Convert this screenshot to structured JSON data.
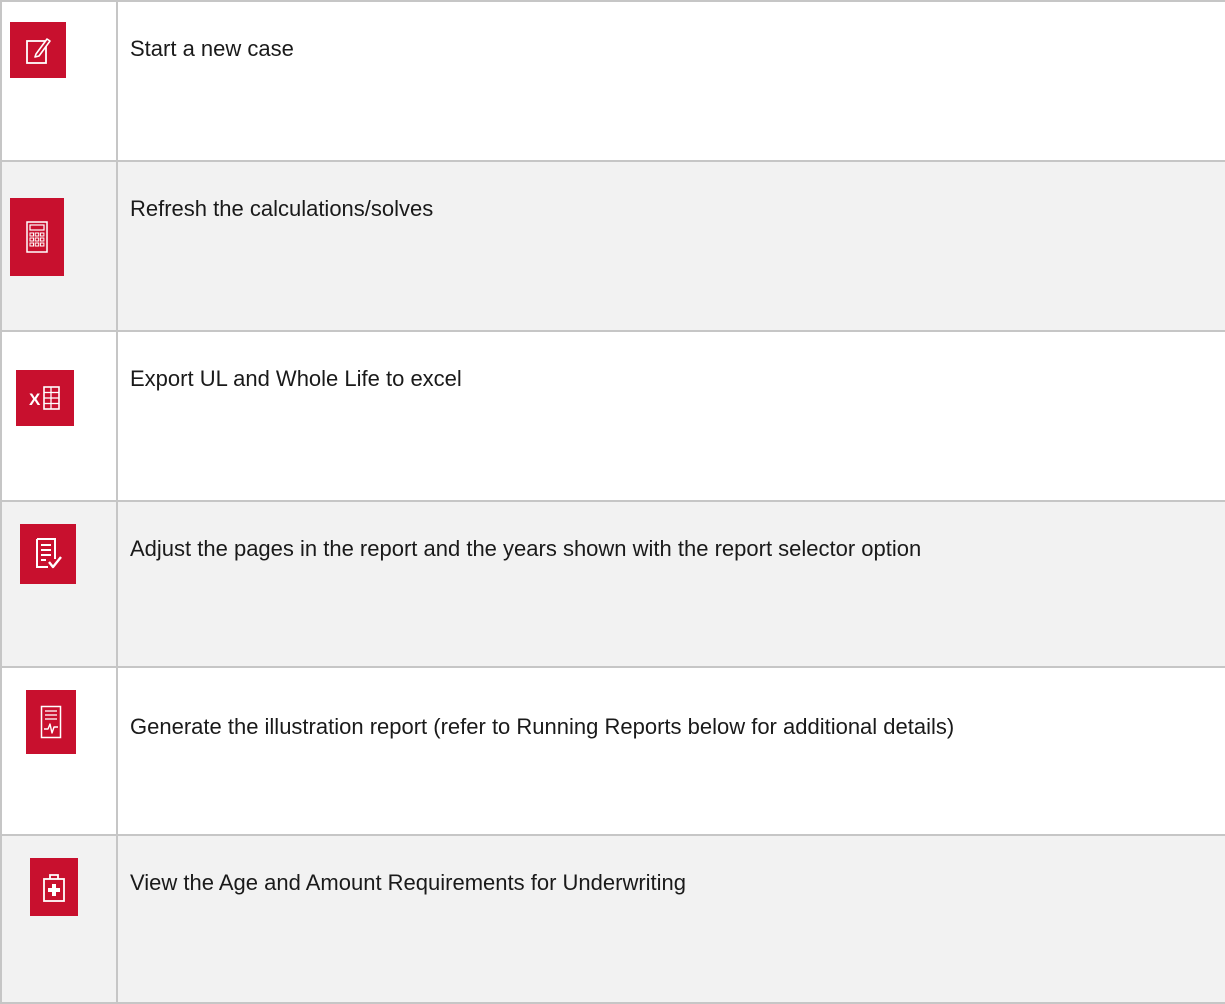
{
  "rows": [
    {
      "icon": "edit-icon",
      "text": "Start a new case"
    },
    {
      "icon": "calculator-icon",
      "text": "Refresh the calculations/solves"
    },
    {
      "icon": "excel-icon",
      "text": "Export UL and Whole Life to excel"
    },
    {
      "icon": "report-selector-icon",
      "text": "Adjust the pages in the report and the years shown with the report selector option"
    },
    {
      "icon": "illustration-report-icon",
      "text": "Generate the illustration report (refer to Running Reports below for additional details)"
    },
    {
      "icon": "medical-kit-icon",
      "text": "View the Age and Amount Requirements for Underwriting"
    }
  ],
  "colors": {
    "accent": "#c8102e",
    "row_shade": "#f2f2f2",
    "border": "#c6c6c6"
  }
}
